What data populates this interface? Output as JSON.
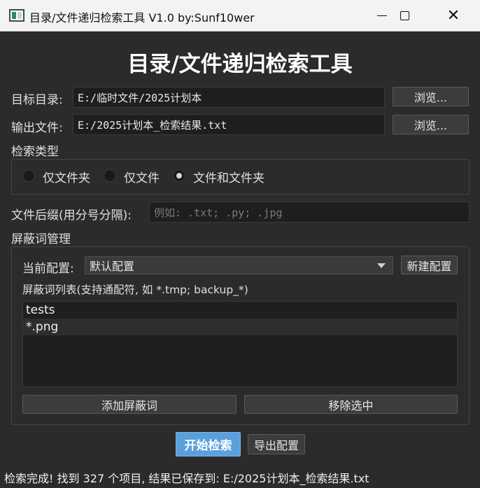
{
  "window": {
    "title": "目录/文件递归检索工具 V1.0 by:Sunf10wer",
    "minimize_icon": "minimize-icon",
    "maximize_icon": "maximize-icon",
    "close_icon": "close-icon"
  },
  "main_title": "目录/文件递归检索工具",
  "target_dir": {
    "label": "目标目录:",
    "value": "E:/临时文件/2025计划本",
    "browse_label": "浏览..."
  },
  "output_file": {
    "label": "输出文件:",
    "value": "E:/2025计划本_检索结果.txt",
    "browse_label": "浏览..."
  },
  "search_type": {
    "title": "检索类型",
    "options": [
      {
        "label": "仅文件夹",
        "checked": false
      },
      {
        "label": "仅文件",
        "checked": false
      },
      {
        "label": "文件和文件夹",
        "checked": true
      }
    ]
  },
  "extension": {
    "label": "文件后缀(用分号分隔):",
    "placeholder": "例如: .txt; .py; .jpg",
    "value": ""
  },
  "block_words": {
    "title": "屏蔽词管理",
    "config_label": "当前配置:",
    "config_value": "默认配置",
    "new_config_label": "新建配置",
    "list_label": "屏蔽词列表(支持通配符, 如 *.tmp; backup_*)",
    "items": [
      "tests",
      "*.png"
    ],
    "add_label": "添加屏蔽词",
    "remove_label": "移除选中"
  },
  "actions": {
    "start_label": "开始检索",
    "export_label": "导出配置"
  },
  "status_text": "检索完成! 找到 327 个项目, 结果已保存到: E:/2025计划本_检索结果.txt",
  "colors": {
    "background": "#2b2b2b",
    "primary_button": "#5aa0dc",
    "titlebar": "#f3f3f3"
  }
}
